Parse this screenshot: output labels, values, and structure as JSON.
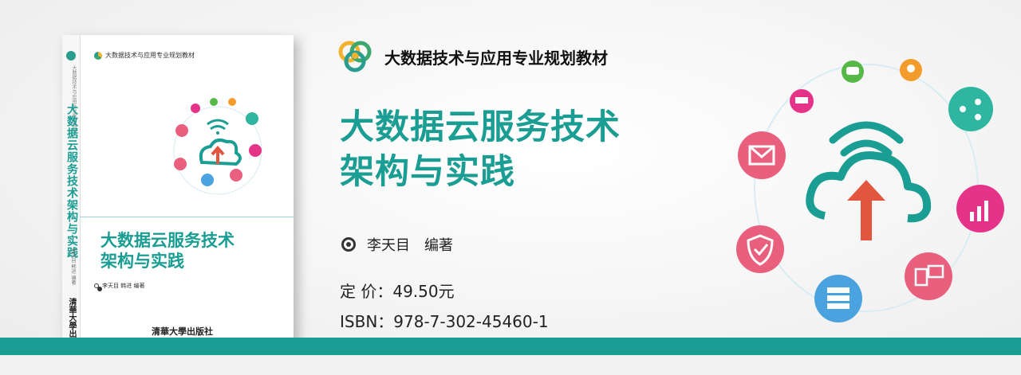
{
  "series": {
    "name": "大数据技术与应用专业规划教材"
  },
  "book": {
    "title_line1": "大数据云服务技术",
    "title_line2": "架构与实践",
    "spine_title": "大数据云服务技术架构与实践",
    "spine_series": "大数据技术与应用专业规划教材",
    "author_line": "李天目  韩进   编著",
    "spine_author": "李天目 韩进 编著",
    "publisher": "清華大學出版社",
    "spine_publisher": "清華大學出版社"
  },
  "info": {
    "author_label": "李天目　编著",
    "price": "定 价：49.50元",
    "isbn": "ISBN：978-7-302-45460-1"
  },
  "colors": {
    "teal": "#1a9d92",
    "pink": "#e8607d",
    "magenta": "#e6338a",
    "green": "#56b947",
    "orange": "#f39c2b",
    "blue": "#4aa3df"
  },
  "icons": [
    "wifi-icon",
    "cloud-upload-icon",
    "chat-icon",
    "location-pin-icon",
    "cart-icon",
    "share-icon",
    "email-icon",
    "chart-icon",
    "shield-icon",
    "server-icon",
    "devices-icon"
  ]
}
